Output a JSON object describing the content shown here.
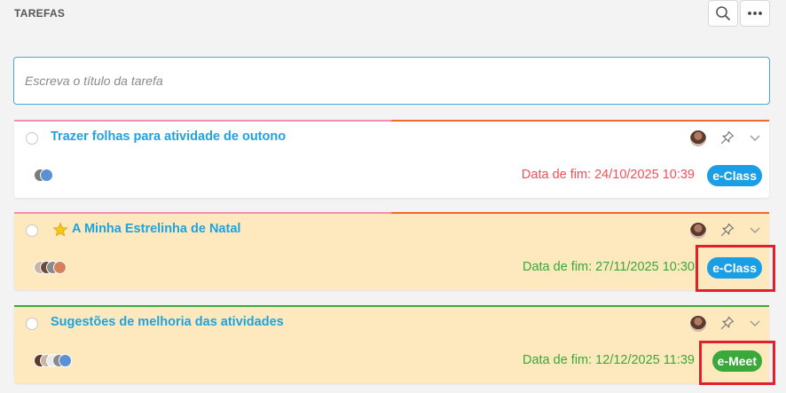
{
  "header": {
    "title": "TAREFAS"
  },
  "new_task": {
    "placeholder": "Escreva o título da tarefa"
  },
  "colors": {
    "card_white": "#ffffff",
    "card_yellow": "#fde9bd",
    "link_blue": "#1fa3de",
    "due_overdue": "#f0505a",
    "due_ok": "#3aa83a",
    "top_pink": "#f48fb1",
    "top_orange": "#f06a2a",
    "top_green": "#3aa83a",
    "eclass": "#1a9ee6",
    "emeet": "#3aa83a",
    "highlight": "#e0202a"
  },
  "tasks": [
    {
      "title": "Trazer folhas para atividade de outono",
      "starred": false,
      "due": "Data de fim: 24/10/2025 10:39",
      "badge": "e-Class",
      "badge_icon": "e-class-badge",
      "due_status": "overdue",
      "assignee_count": 2,
      "highlighted": false
    },
    {
      "title": "A Minha Estrelinha de Natal",
      "starred": true,
      "due": "Data de fim: 27/11/2025 10:30",
      "badge": "e-Class",
      "badge_icon": "e-class-badge",
      "due_status": "ok",
      "assignee_count": 4,
      "highlighted": true
    },
    {
      "title": "Sugestões de melhoria das atividades",
      "starred": false,
      "due": "Data de fim: 12/12/2025 11:39",
      "badge": "e-Meet",
      "badge_icon": "e-meet-badge",
      "due_status": "ok",
      "assignee_count": 5,
      "highlighted": true
    }
  ]
}
